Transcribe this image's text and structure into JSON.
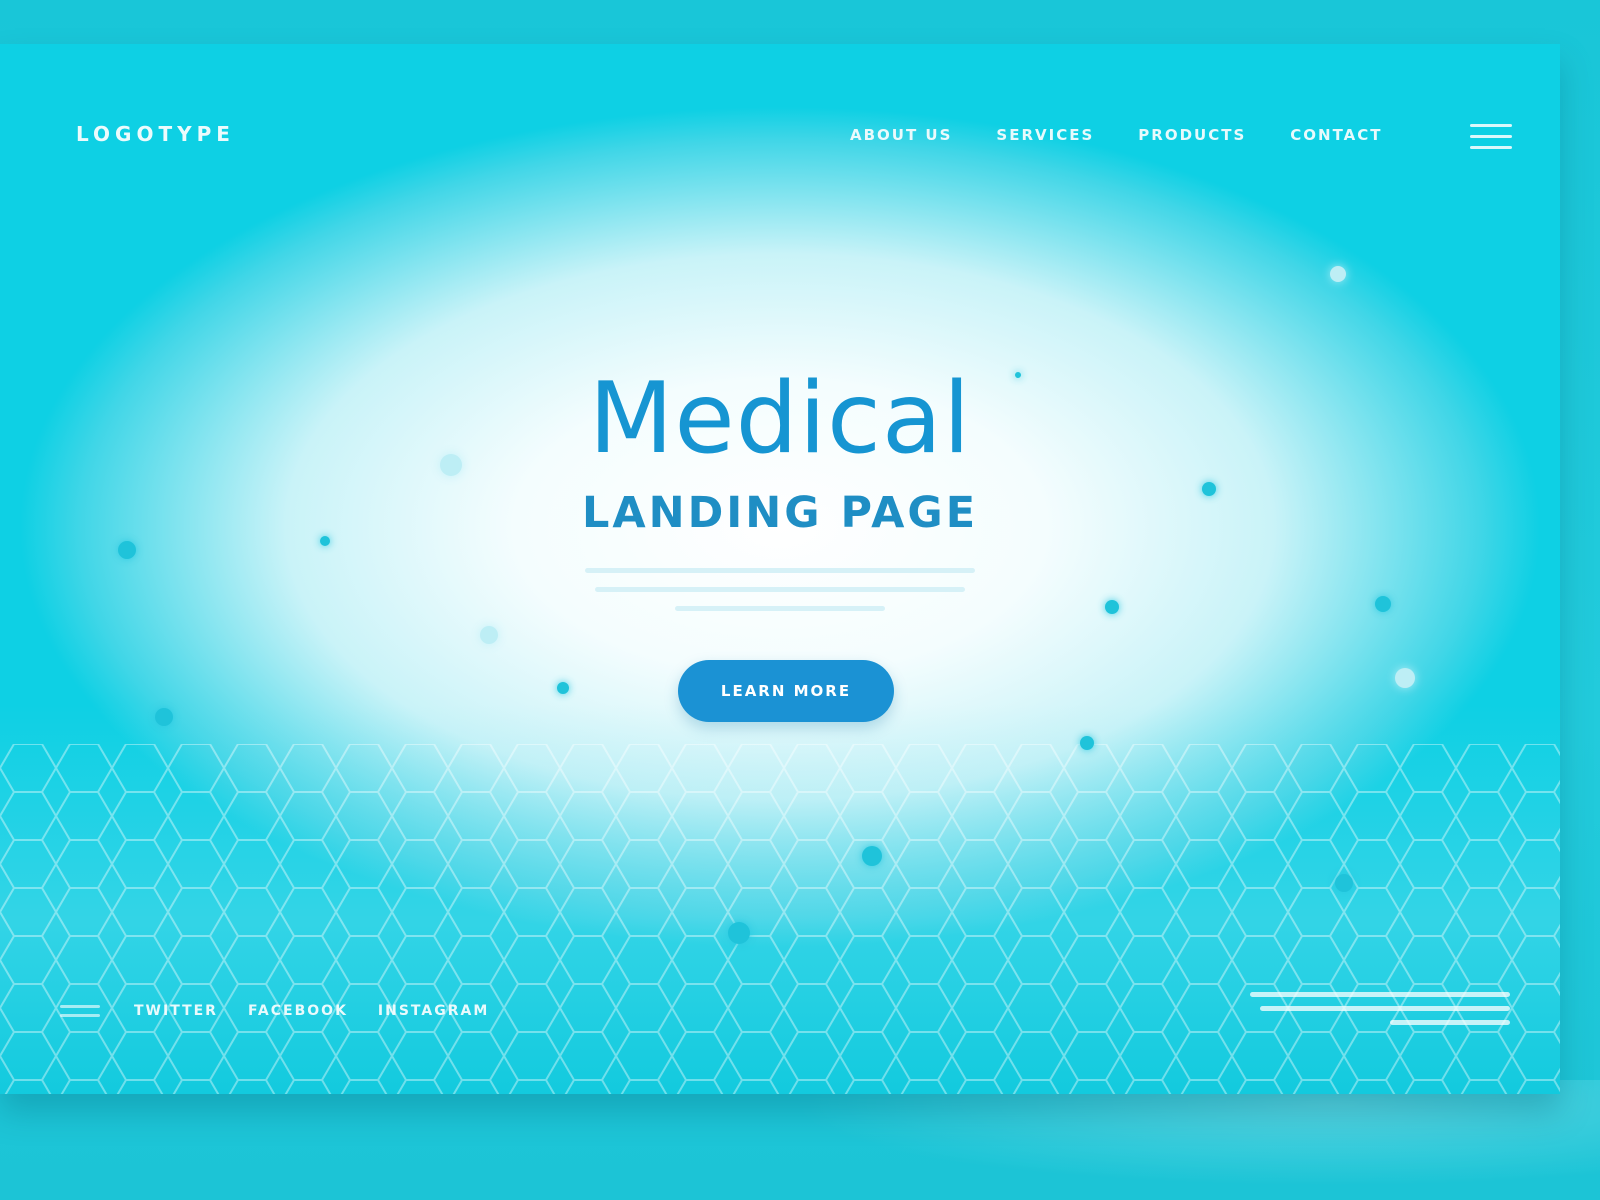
{
  "nav": {
    "logo": "LOGOTYPE",
    "menu": [
      "ABOUT US",
      "SERVICES",
      "PRODUCTS",
      "CONTACT"
    ],
    "hamburger_icon": "menu-icon"
  },
  "hero": {
    "title": "Medical",
    "subtitle": "LANDING PAGE",
    "cta_label": "LEARN MORE"
  },
  "footer": {
    "menu_icon": "menu-icon",
    "links": [
      "TWITTER",
      "FACEBOOK",
      "INSTAGRAM"
    ]
  },
  "colors": {
    "primary": "#1695d2",
    "accent": "#1fc9da",
    "button": "#1b92d4",
    "text_light": "#ffffff"
  }
}
